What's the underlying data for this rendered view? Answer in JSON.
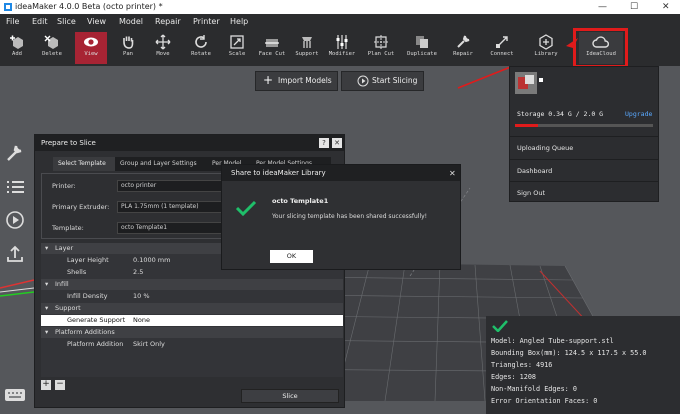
{
  "window": {
    "title": "ideaMaker 4.0.0 Beta (octo printer)  *",
    "minimize": "—",
    "maximize": "☐",
    "close": "✕"
  },
  "menu": [
    "File",
    "Edit",
    "Slice",
    "View",
    "Model",
    "Repair",
    "Printer",
    "Help"
  ],
  "toolbar": [
    "Add",
    "Delete",
    "View",
    "Pan",
    "Move",
    "Rotate",
    "Scale",
    "Face Cut",
    "Support",
    "Modifier",
    "Plan Cut",
    "Duplicate",
    "Repair",
    "Connect",
    "Library",
    "IdeaCloud"
  ],
  "actions": {
    "import": "Import Models",
    "slice": "Start Slicing"
  },
  "account": {
    "storage": "Storage  0.34 G / 2.0 G",
    "upgrade": "Upgrade",
    "storage_fraction": 0.17,
    "items": [
      "Uploading Queue",
      "Dashboard",
      "Sign Out"
    ]
  },
  "prepare": {
    "title": "Prepare to Slice",
    "help": "?",
    "close": "✕",
    "tabs": [
      "Select Template",
      "Group and Layer Settings",
      "Per Model",
      "Per Model Settings"
    ],
    "printer_label": "Printer:",
    "printer_value": "octo printer",
    "extruder_label": "Primary Extruder:",
    "extruder_value": "PLA 1.75mm (1 template)",
    "template_label": "Template:",
    "template_value": "octo Template1",
    "tree": [
      {
        "type": "section",
        "name": "Layer"
      },
      {
        "type": "item",
        "name": "Layer Height",
        "value": "0.1000 mm"
      },
      {
        "type": "item",
        "name": "Shells",
        "value": "2.5"
      },
      {
        "type": "section",
        "name": "Infill"
      },
      {
        "type": "item",
        "name": "Infill Density",
        "value": "10 %"
      },
      {
        "type": "section",
        "name": "Support"
      },
      {
        "type": "item",
        "name": "Generate Support",
        "value": "None"
      },
      {
        "type": "section",
        "name": "Platform Additions"
      },
      {
        "type": "item",
        "name": "Platform Addition",
        "value": "Skirt Only"
      }
    ],
    "add": "+",
    "remove": "−",
    "slice_button": "Slice"
  },
  "share": {
    "title": "Share to ideaMaker Library",
    "close": "✕",
    "name": "octo Template1",
    "message": "Your slicing template has been shared successfully!",
    "ok": "OK"
  },
  "model_info": {
    "lines": [
      "Model: Angled Tube-support.stl",
      "Bounding Box(mm): 124.5 x 117.5 x 55.0",
      "Triangles: 4916",
      "Edges: 1208",
      "Non-Manifold Edges: 0",
      "Error Orientation Faces: 0"
    ]
  },
  "colors": {
    "accent": "#a72434",
    "highlight_box": "#e01b1b",
    "check": "#1fbf6a",
    "upgrade": "#5aa9ff"
  }
}
